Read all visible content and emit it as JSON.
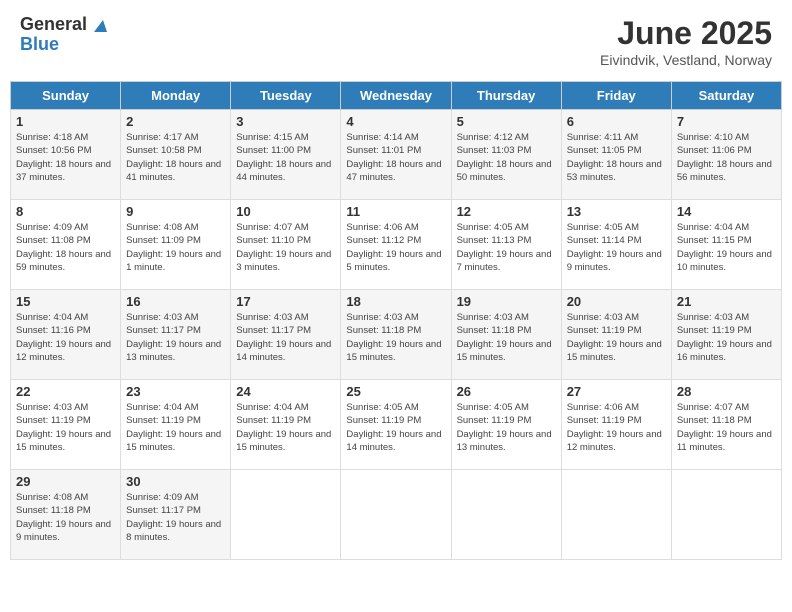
{
  "logo": {
    "general": "General",
    "blue": "Blue"
  },
  "title": "June 2025",
  "subtitle": "Eivindvik, Vestland, Norway",
  "headers": [
    "Sunday",
    "Monday",
    "Tuesday",
    "Wednesday",
    "Thursday",
    "Friday",
    "Saturday"
  ],
  "weeks": [
    [
      {
        "day": "1",
        "sunrise": "Sunrise: 4:18 AM",
        "sunset": "Sunset: 10:56 PM",
        "daylight": "Daylight: 18 hours and 37 minutes."
      },
      {
        "day": "2",
        "sunrise": "Sunrise: 4:17 AM",
        "sunset": "Sunset: 10:58 PM",
        "daylight": "Daylight: 18 hours and 41 minutes."
      },
      {
        "day": "3",
        "sunrise": "Sunrise: 4:15 AM",
        "sunset": "Sunset: 11:00 PM",
        "daylight": "Daylight: 18 hours and 44 minutes."
      },
      {
        "day": "4",
        "sunrise": "Sunrise: 4:14 AM",
        "sunset": "Sunset: 11:01 PM",
        "daylight": "Daylight: 18 hours and 47 minutes."
      },
      {
        "day": "5",
        "sunrise": "Sunrise: 4:12 AM",
        "sunset": "Sunset: 11:03 PM",
        "daylight": "Daylight: 18 hours and 50 minutes."
      },
      {
        "day": "6",
        "sunrise": "Sunrise: 4:11 AM",
        "sunset": "Sunset: 11:05 PM",
        "daylight": "Daylight: 18 hours and 53 minutes."
      },
      {
        "day": "7",
        "sunrise": "Sunrise: 4:10 AM",
        "sunset": "Sunset: 11:06 PM",
        "daylight": "Daylight: 18 hours and 56 minutes."
      }
    ],
    [
      {
        "day": "8",
        "sunrise": "Sunrise: 4:09 AM",
        "sunset": "Sunset: 11:08 PM",
        "daylight": "Daylight: 18 hours and 59 minutes."
      },
      {
        "day": "9",
        "sunrise": "Sunrise: 4:08 AM",
        "sunset": "Sunset: 11:09 PM",
        "daylight": "Daylight: 19 hours and 1 minute."
      },
      {
        "day": "10",
        "sunrise": "Sunrise: 4:07 AM",
        "sunset": "Sunset: 11:10 PM",
        "daylight": "Daylight: 19 hours and 3 minutes."
      },
      {
        "day": "11",
        "sunrise": "Sunrise: 4:06 AM",
        "sunset": "Sunset: 11:12 PM",
        "daylight": "Daylight: 19 hours and 5 minutes."
      },
      {
        "day": "12",
        "sunrise": "Sunrise: 4:05 AM",
        "sunset": "Sunset: 11:13 PM",
        "daylight": "Daylight: 19 hours and 7 minutes."
      },
      {
        "day": "13",
        "sunrise": "Sunrise: 4:05 AM",
        "sunset": "Sunset: 11:14 PM",
        "daylight": "Daylight: 19 hours and 9 minutes."
      },
      {
        "day": "14",
        "sunrise": "Sunrise: 4:04 AM",
        "sunset": "Sunset: 11:15 PM",
        "daylight": "Daylight: 19 hours and 10 minutes."
      }
    ],
    [
      {
        "day": "15",
        "sunrise": "Sunrise: 4:04 AM",
        "sunset": "Sunset: 11:16 PM",
        "daylight": "Daylight: 19 hours and 12 minutes."
      },
      {
        "day": "16",
        "sunrise": "Sunrise: 4:03 AM",
        "sunset": "Sunset: 11:17 PM",
        "daylight": "Daylight: 19 hours and 13 minutes."
      },
      {
        "day": "17",
        "sunrise": "Sunrise: 4:03 AM",
        "sunset": "Sunset: 11:17 PM",
        "daylight": "Daylight: 19 hours and 14 minutes."
      },
      {
        "day": "18",
        "sunrise": "Sunrise: 4:03 AM",
        "sunset": "Sunset: 11:18 PM",
        "daylight": "Daylight: 19 hours and 15 minutes."
      },
      {
        "day": "19",
        "sunrise": "Sunrise: 4:03 AM",
        "sunset": "Sunset: 11:18 PM",
        "daylight": "Daylight: 19 hours and 15 minutes."
      },
      {
        "day": "20",
        "sunrise": "Sunrise: 4:03 AM",
        "sunset": "Sunset: 11:19 PM",
        "daylight": "Daylight: 19 hours and 15 minutes."
      },
      {
        "day": "21",
        "sunrise": "Sunrise: 4:03 AM",
        "sunset": "Sunset: 11:19 PM",
        "daylight": "Daylight: 19 hours and 16 minutes."
      }
    ],
    [
      {
        "day": "22",
        "sunrise": "Sunrise: 4:03 AM",
        "sunset": "Sunset: 11:19 PM",
        "daylight": "Daylight: 19 hours and 15 minutes."
      },
      {
        "day": "23",
        "sunrise": "Sunrise: 4:04 AM",
        "sunset": "Sunset: 11:19 PM",
        "daylight": "Daylight: 19 hours and 15 minutes."
      },
      {
        "day": "24",
        "sunrise": "Sunrise: 4:04 AM",
        "sunset": "Sunset: 11:19 PM",
        "daylight": "Daylight: 19 hours and 15 minutes."
      },
      {
        "day": "25",
        "sunrise": "Sunrise: 4:05 AM",
        "sunset": "Sunset: 11:19 PM",
        "daylight": "Daylight: 19 hours and 14 minutes."
      },
      {
        "day": "26",
        "sunrise": "Sunrise: 4:05 AM",
        "sunset": "Sunset: 11:19 PM",
        "daylight": "Daylight: 19 hours and 13 minutes."
      },
      {
        "day": "27",
        "sunrise": "Sunrise: 4:06 AM",
        "sunset": "Sunset: 11:19 PM",
        "daylight": "Daylight: 19 hours and 12 minutes."
      },
      {
        "day": "28",
        "sunrise": "Sunrise: 4:07 AM",
        "sunset": "Sunset: 11:18 PM",
        "daylight": "Daylight: 19 hours and 11 minutes."
      }
    ],
    [
      {
        "day": "29",
        "sunrise": "Sunrise: 4:08 AM",
        "sunset": "Sunset: 11:18 PM",
        "daylight": "Daylight: 19 hours and 9 minutes."
      },
      {
        "day": "30",
        "sunrise": "Sunrise: 4:09 AM",
        "sunset": "Sunset: 11:17 PM",
        "daylight": "Daylight: 19 hours and 8 minutes."
      },
      null,
      null,
      null,
      null,
      null
    ]
  ]
}
